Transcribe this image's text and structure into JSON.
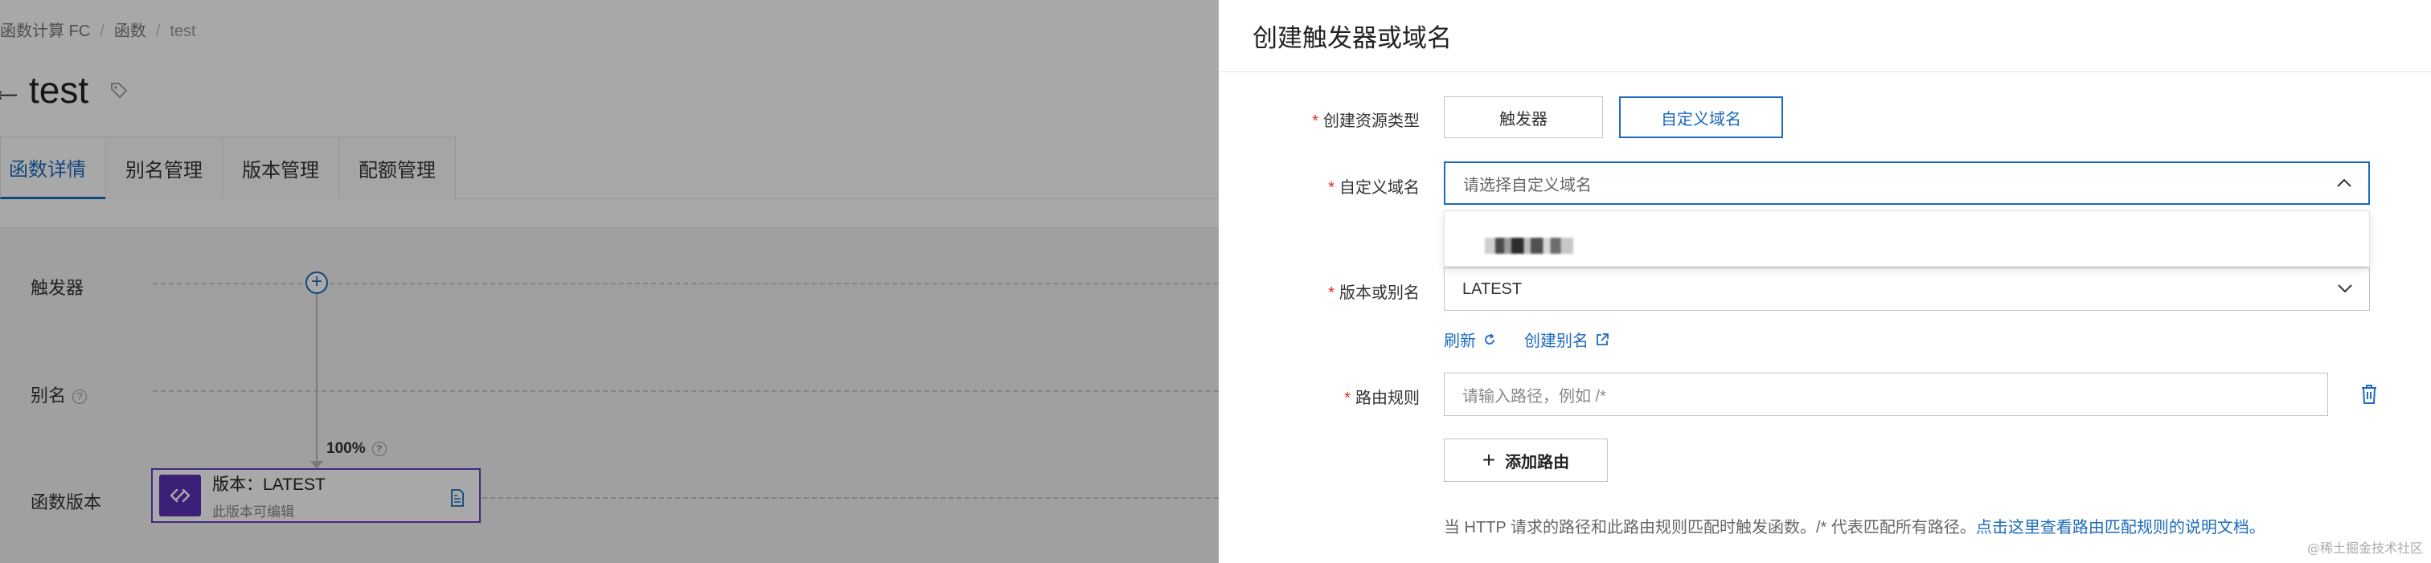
{
  "background_page": {
    "breadcrumb": [
      "函数计算 FC",
      "函数",
      "test"
    ],
    "title": "test",
    "tabs": [
      "函数详情",
      "别名管理",
      "版本管理",
      "配额管理"
    ],
    "rows": {
      "trigger_label": "触发器",
      "alias_label": "别名",
      "version_label": "函数版本"
    },
    "traffic_percent": "100%",
    "version_card": {
      "title": "版本：LATEST",
      "subtitle": "此版本可编辑"
    }
  },
  "drawer": {
    "title": "创建触发器或域名",
    "resource_type": {
      "label": "创建资源类型",
      "options": [
        "触发器",
        "自定义域名"
      ],
      "selected": "自定义域名"
    },
    "custom_domain": {
      "label": "自定义域名",
      "placeholder": "请选择自定义域名",
      "dropdown_open": true
    },
    "version_alias": {
      "label": "版本或别名",
      "value": "LATEST"
    },
    "links": {
      "refresh": "刷新",
      "create_alias": "创建别名"
    },
    "route_rule": {
      "label": "路由规则",
      "placeholder": "请输入路径，例如 /*"
    },
    "add_route_label": "添加路由",
    "help_text": "当 HTTP 请求的路径和此路由规则匹配时触发函数。/* 代表匹配所有路径。",
    "help_link": "点击这里查看路由匹配规则的说明文档。"
  },
  "watermark": "@稀土掘金技术社区",
  "colors": {
    "accent": "#1c6bbd",
    "required": "#d93026",
    "version_purple": "#5b2fb5"
  }
}
